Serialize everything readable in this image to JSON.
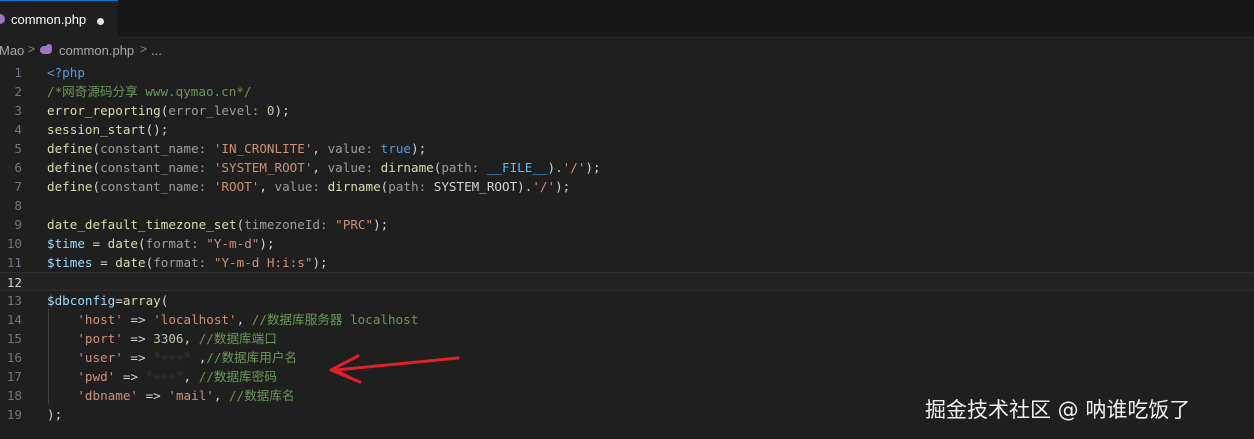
{
  "tab": {
    "label": "common.php",
    "icon": "php-elephant-icon",
    "modified": true
  },
  "breadcrumb": {
    "segment1": "Mao",
    "separator": ">",
    "file": "common.php",
    "more": "..."
  },
  "lines": [
    {
      "n": "1",
      "tokens": [
        {
          "c": "tag",
          "t": "<?php"
        }
      ]
    },
    {
      "n": "2",
      "tokens": [
        {
          "c": "com",
          "t": "/*网奇源码分享 www.qymao.cn*/"
        }
      ]
    },
    {
      "n": "3",
      "tokens": [
        {
          "c": "fn",
          "t": "error_reporting"
        },
        {
          "c": "txt",
          "t": "("
        },
        {
          "c": "hint",
          "t": "error_level: "
        },
        {
          "c": "num",
          "t": "0"
        },
        {
          "c": "txt",
          "t": ");"
        }
      ]
    },
    {
      "n": "4",
      "tokens": [
        {
          "c": "fn",
          "t": "session_start"
        },
        {
          "c": "txt",
          "t": "();"
        }
      ]
    },
    {
      "n": "5",
      "tokens": [
        {
          "c": "fn",
          "t": "define"
        },
        {
          "c": "txt",
          "t": "("
        },
        {
          "c": "hint",
          "t": "constant_name: "
        },
        {
          "c": "str",
          "t": "'IN_CRONLITE'"
        },
        {
          "c": "txt",
          "t": ", "
        },
        {
          "c": "hint",
          "t": "value: "
        },
        {
          "c": "kw",
          "t": "true"
        },
        {
          "c": "txt",
          "t": ");"
        }
      ]
    },
    {
      "n": "6",
      "tokens": [
        {
          "c": "fn",
          "t": "define"
        },
        {
          "c": "txt",
          "t": "("
        },
        {
          "c": "hint",
          "t": "constant_name: "
        },
        {
          "c": "str",
          "t": "'SYSTEM_ROOT'"
        },
        {
          "c": "txt",
          "t": ", "
        },
        {
          "c": "hint",
          "t": "value: "
        },
        {
          "c": "fn",
          "t": "dirname"
        },
        {
          "c": "txt",
          "t": "("
        },
        {
          "c": "hint",
          "t": "path: "
        },
        {
          "c": "const",
          "t": "__FILE__"
        },
        {
          "c": "txt",
          "t": ")."
        },
        {
          "c": "str",
          "t": "'/'"
        },
        {
          "c": "txt",
          "t": ");"
        }
      ]
    },
    {
      "n": "7",
      "tokens": [
        {
          "c": "fn",
          "t": "define"
        },
        {
          "c": "txt",
          "t": "("
        },
        {
          "c": "hint",
          "t": "constant_name: "
        },
        {
          "c": "str",
          "t": "'ROOT'"
        },
        {
          "c": "txt",
          "t": ", "
        },
        {
          "c": "hint",
          "t": "value: "
        },
        {
          "c": "fn",
          "t": "dirname"
        },
        {
          "c": "txt",
          "t": "("
        },
        {
          "c": "hint",
          "t": "path: "
        },
        {
          "c": "txt",
          "t": "SYSTEM_ROOT)."
        },
        {
          "c": "str",
          "t": "'/'"
        },
        {
          "c": "txt",
          "t": ");"
        }
      ]
    },
    {
      "n": "8",
      "tokens": []
    },
    {
      "n": "9",
      "tokens": [
        {
          "c": "fn",
          "t": "date_default_timezone_set"
        },
        {
          "c": "txt",
          "t": "("
        },
        {
          "c": "hint",
          "t": "timezoneId: "
        },
        {
          "c": "str",
          "t": "\"PRC\""
        },
        {
          "c": "txt",
          "t": ");"
        }
      ]
    },
    {
      "n": "10",
      "tokens": [
        {
          "c": "var",
          "t": "$time"
        },
        {
          "c": "txt",
          "t": " = "
        },
        {
          "c": "fn",
          "t": "date"
        },
        {
          "c": "txt",
          "t": "("
        },
        {
          "c": "hint",
          "t": "format: "
        },
        {
          "c": "str",
          "t": "\"Y-m-d\""
        },
        {
          "c": "txt",
          "t": ");"
        }
      ]
    },
    {
      "n": "11",
      "tokens": [
        {
          "c": "var",
          "t": "$times"
        },
        {
          "c": "txt",
          "t": " = "
        },
        {
          "c": "fn",
          "t": "date"
        },
        {
          "c": "txt",
          "t": "("
        },
        {
          "c": "hint",
          "t": "format: "
        },
        {
          "c": "str",
          "t": "\"Y-m-d H:i:s\""
        },
        {
          "c": "txt",
          "t": ");"
        }
      ]
    },
    {
      "n": "12",
      "tokens": [],
      "active": true
    },
    {
      "n": "13",
      "tokens": [
        {
          "c": "var",
          "t": "$dbconfig"
        },
        {
          "c": "txt",
          "t": "="
        },
        {
          "c": "fn",
          "t": "array"
        },
        {
          "c": "txt",
          "t": "("
        }
      ]
    },
    {
      "n": "14",
      "tokens": [
        {
          "c": "txt",
          "t": "    "
        },
        {
          "c": "str",
          "t": "'host'"
        },
        {
          "c": "txt",
          "t": " => "
        },
        {
          "c": "str",
          "t": "'localhost'"
        },
        {
          "c": "txt",
          "t": ", "
        },
        {
          "c": "com",
          "t": "//数据库服务器 localhost"
        }
      ]
    },
    {
      "n": "15",
      "tokens": [
        {
          "c": "txt",
          "t": "    "
        },
        {
          "c": "str",
          "t": "'port'"
        },
        {
          "c": "txt",
          "t": " => "
        },
        {
          "c": "num",
          "t": "3306"
        },
        {
          "c": "txt",
          "t": ", "
        },
        {
          "c": "com",
          "t": "//数据库端口"
        }
      ]
    },
    {
      "n": "16",
      "tokens": [
        {
          "c": "txt",
          "t": "    "
        },
        {
          "c": "str",
          "t": "'user'"
        },
        {
          "c": "txt",
          "t": " => "
        },
        {
          "c": "blur",
          "t": "'···'"
        },
        {
          "c": "txt",
          "t": " ,"
        },
        {
          "c": "com",
          "t": "//数据库用户名"
        }
      ]
    },
    {
      "n": "17",
      "tokens": [
        {
          "c": "txt",
          "t": "    "
        },
        {
          "c": "str",
          "t": "'pwd'"
        },
        {
          "c": "txt",
          "t": " => "
        },
        {
          "c": "blur",
          "t": "'···'"
        },
        {
          "c": "txt",
          "t": ", "
        },
        {
          "c": "com",
          "t": "//数据库密码"
        }
      ]
    },
    {
      "n": "18",
      "tokens": [
        {
          "c": "txt",
          "t": "    "
        },
        {
          "c": "str",
          "t": "'dbname'"
        },
        {
          "c": "txt",
          "t": " => "
        },
        {
          "c": "str",
          "t": "'mail'"
        },
        {
          "c": "txt",
          "t": ", "
        },
        {
          "c": "com",
          "t": "//数据库名"
        }
      ]
    },
    {
      "n": "19",
      "tokens": [
        {
          "c": "txt",
          "t": ");"
        }
      ]
    }
  ],
  "watermark": "掘金技术社区 @ 呐谁吃饭了",
  "colors": {
    "background": "#1f1f1f",
    "annotation_arrow": "#e0202a",
    "tab_accent": "#0078d4"
  }
}
